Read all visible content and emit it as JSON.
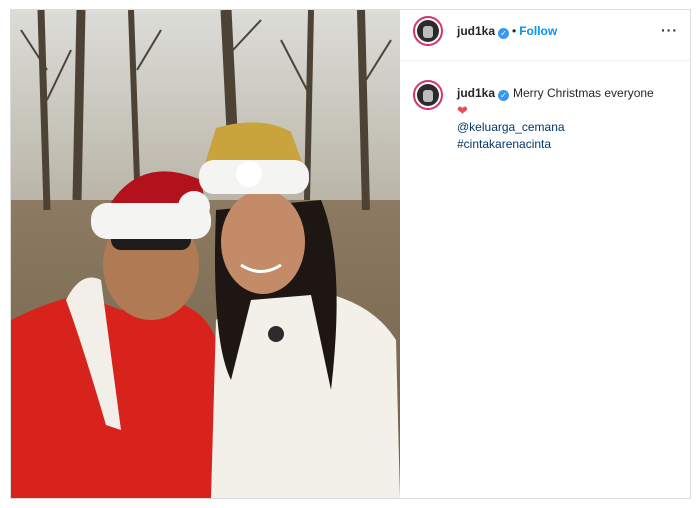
{
  "post": {
    "author": {
      "username": "jud1ka",
      "verified_icon": "verified-badge-icon",
      "follow_label": "Follow",
      "separator": "•"
    },
    "more_label": "···",
    "caption": {
      "username": "jud1ka",
      "text": "Merry Christmas everyone",
      "emoji": "❤",
      "mention": "@keluarga_cemana",
      "hashtag": "#cintakarenacinta"
    },
    "colors": {
      "follow": "#0095f6",
      "verified": "#3897f0",
      "story_ring": "#d6336c",
      "heart": "#ed4956",
      "link": "#00376b"
    }
  }
}
